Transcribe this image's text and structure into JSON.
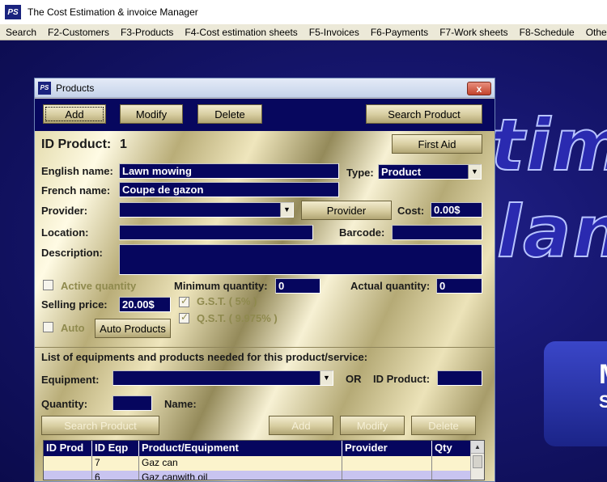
{
  "app": {
    "title": "The Cost Estimation & invoice Manager",
    "logo": "PS"
  },
  "menu": [
    "Search",
    "F2-Customers",
    "F3-Products",
    "F4-Cost estimation sheets",
    "F5-Invoices",
    "F6-Payments",
    "F7-Work sheets",
    "F8-Schedule",
    "Other"
  ],
  "background": {
    "line1": "tima",
    "line2": "lana",
    "panel_m": "M",
    "panel_s": "S"
  },
  "window": {
    "title": "Products",
    "close": "x"
  },
  "toolbar": {
    "add": "Add",
    "modify": "Modify",
    "delete": "Delete",
    "search_product": "Search Product"
  },
  "form": {
    "id_label": "ID Product:",
    "id_value": "1",
    "first_aid": "First Aid",
    "english_label": "English name:",
    "english_value": "Lawn mowing",
    "type_label": "Type:",
    "type_value": "Product",
    "french_label": "French name:",
    "french_value": "Coupe de gazon",
    "provider_label": "Provider:",
    "provider_value": "",
    "provider_button": "Provider",
    "cost_label": "Cost:",
    "cost_value": "0.00$",
    "location_label": "Location:",
    "location_value": "",
    "barcode_label": "Barcode:",
    "barcode_value": "",
    "description_label": "Description:",
    "description_value": "",
    "active_qty_label": "Active quantity",
    "min_qty_label": "Minimum quantity:",
    "min_qty_value": "0",
    "actual_qty_label": "Actual quantity:",
    "actual_qty_value": "0",
    "selling_label": "Selling price:",
    "selling_value": "20.00$",
    "gst_label": "G.S.T.  ( 5% )",
    "qst_label": "Q.S.T.  ( 9.975% )",
    "auto_label": "Auto",
    "auto_products": "Auto Products"
  },
  "equipment": {
    "section_label": "List of equipments and products needed for this product/service:",
    "equipment_label": "Equipment:",
    "equipment_value": "",
    "or_label": "OR",
    "id_product_label": "ID Product:",
    "id_product_value": "",
    "quantity_label": "Quantity:",
    "quantity_value": "",
    "name_label": "Name:",
    "search_product": "Search Product",
    "add": "Add",
    "modify": "Modify",
    "delete": "Delete"
  },
  "grid": {
    "columns": [
      "ID Prod",
      "ID Eqp",
      "Product/Equipment",
      "Provider",
      "Qty"
    ],
    "rows": [
      {
        "id_prod": "",
        "id_eqp": "7",
        "name": "Gaz can",
        "provider": "",
        "qty": ""
      },
      {
        "id_prod": "",
        "id_eqp": "6",
        "name": "Gaz canwith oil",
        "provider": "",
        "qty": ""
      }
    ]
  },
  "colors": {
    "field_bg": "#06065e",
    "app_bg": "#0a0a50",
    "gold_panel": "#d6cc9f"
  }
}
